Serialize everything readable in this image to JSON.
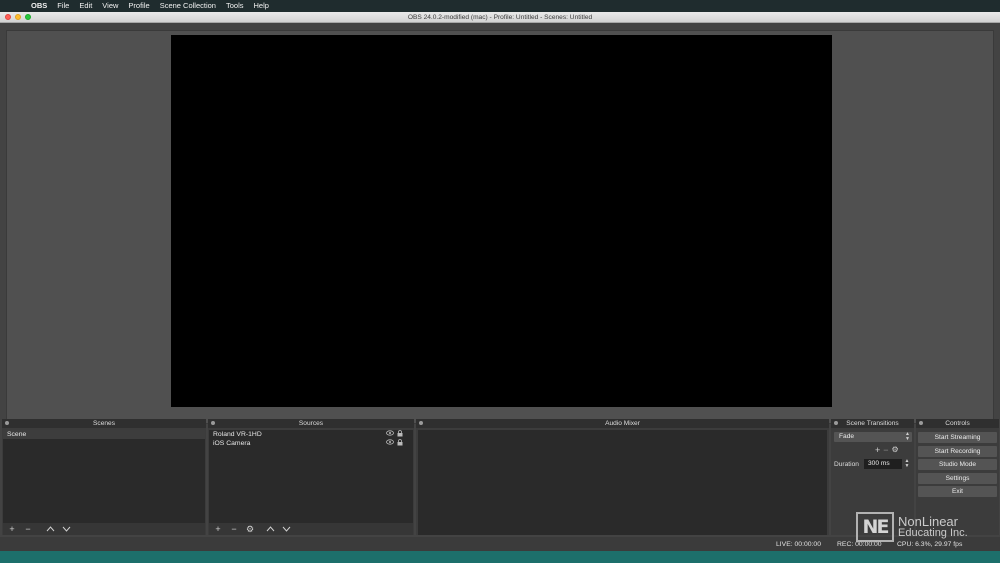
{
  "menubar": {
    "apple_icon": "apple-logo-icon",
    "items": [
      "OBS",
      "File",
      "Edit",
      "View",
      "Profile",
      "Scene Collection",
      "Tools",
      "Help"
    ]
  },
  "window": {
    "title": "OBS 24.0.2-modified (mac) - Profile: Untitled - Scenes: Untitled"
  },
  "scenes": {
    "title": "Scenes",
    "items": [
      "Scene"
    ],
    "toolbar_icons": [
      "plus-icon",
      "minus-icon",
      "chevron-up-icon",
      "chevron-down-icon"
    ]
  },
  "sources": {
    "title": "Sources",
    "items": [
      {
        "name": "Roland VR-1HD",
        "icons": [
          "eye-icon",
          "lock-icon"
        ]
      },
      {
        "name": "iOS Camera",
        "icons": [
          "eye-icon",
          "lock-icon"
        ]
      }
    ],
    "toolbar_icons": [
      "plus-icon",
      "minus-icon",
      "gear-icon",
      "chevron-up-icon",
      "chevron-down-icon"
    ]
  },
  "audio_mixer": {
    "title": "Audio Mixer"
  },
  "transitions": {
    "title": "Scene Transitions",
    "selected": "Fade",
    "duration_label": "Duration",
    "duration_value": "300 ms"
  },
  "controls": {
    "title": "Controls",
    "buttons": [
      "Start Streaming",
      "Start Recording",
      "Studio Mode",
      "Settings",
      "Exit"
    ]
  },
  "status": {
    "live": "LIVE: 00:00:00",
    "rec": "REC: 00:00:00",
    "cpu": "CPU: 6.3%, 29.97 fps"
  },
  "watermark": {
    "logo": "NE",
    "line1": "NonLinear",
    "line2": "Educating Inc."
  },
  "colors": {
    "desktop": "#1d6f6b",
    "panel": "#3c3c3c",
    "canvas": "#000000"
  }
}
